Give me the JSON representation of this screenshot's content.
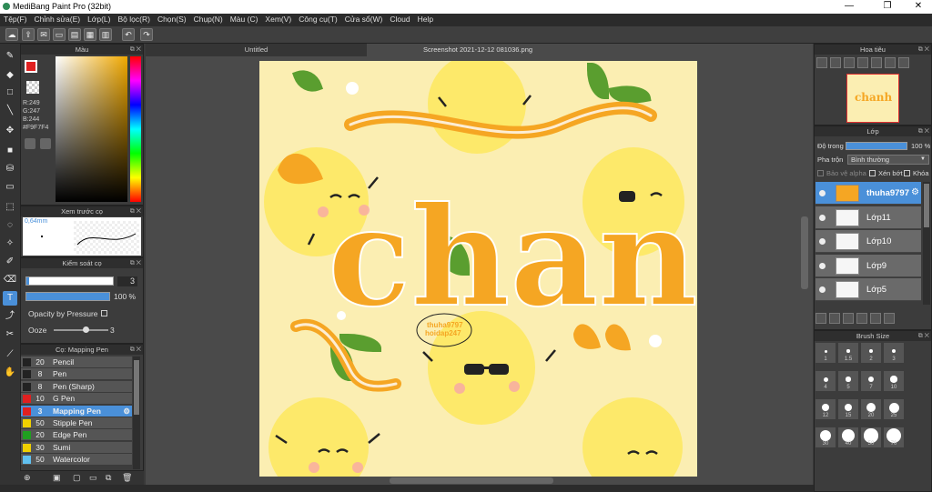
{
  "window": {
    "title": "MediBang Paint Pro (32bit)",
    "minimize": "—",
    "maximize": "❐",
    "close": "✕"
  },
  "menu": [
    "Tệp(F)",
    "Chỉnh sửa(E)",
    "Lớp(L)",
    "Bộ lọc(R)",
    "Chọn(S)",
    "Chụp(N)",
    "Màu (C)",
    "Xem(V)",
    "Công cụ(T)",
    "Cửa sổ(W)",
    "Cloud",
    "Help"
  ],
  "color_panel": {
    "title": "Màu",
    "r": "R:249",
    "g": "G:247",
    "b": "B:244",
    "hex": "#F9F7F4"
  },
  "brush_preview": {
    "title": "Xem trước cọ",
    "size": "0,64mm"
  },
  "brush_control": {
    "title": "Kiểm soát cọ",
    "size_value": "3",
    "opacity_value": "100 %",
    "opacity_pressure": "Opacity by Pressure",
    "ooze_label": "Ooze",
    "ooze_value": "3"
  },
  "brush_list": {
    "title": "Cọ: Mapping Pen",
    "items": [
      {
        "size": "20",
        "name": "Pencil",
        "color": "#222222"
      },
      {
        "size": "8",
        "name": "Pen",
        "color": "#222222"
      },
      {
        "size": "8",
        "name": "Pen (Sharp)",
        "color": "#222222"
      },
      {
        "size": "10",
        "name": "G Pen",
        "color": "#e02020"
      },
      {
        "size": "3",
        "name": "Mapping Pen",
        "color": "#e02020"
      },
      {
        "size": "50",
        "name": "Stipple Pen",
        "color": "#f0d000"
      },
      {
        "size": "20",
        "name": "Edge Pen",
        "color": "#20a020"
      },
      {
        "size": "30",
        "name": "Sumi",
        "color": "#f0d000"
      },
      {
        "size": "50",
        "name": "Watercolor",
        "color": "#60c0f0"
      }
    ]
  },
  "tabs": {
    "untitled": "Untitled",
    "screenshot": "Screenshot 2021-12-12 081036.png"
  },
  "artwork": {
    "word": "chanh",
    "signature_line1": "thuha9797",
    "signature_line2": "hoidap247"
  },
  "navigator": {
    "title": "Hoa tiêu"
  },
  "layers": {
    "title": "Lớp",
    "opacity_label": "Độ trong",
    "opacity_value": "100 %",
    "blend_label": "Pha trộn",
    "blend_value": "Bình thường",
    "protect_alpha": "Bảo vệ alpha",
    "clipping": "Xén bớt",
    "lock": "Khóa",
    "items": [
      "thuha9797",
      "Lớp11",
      "Lớp10",
      "Lớp9",
      "Lớp5"
    ]
  },
  "brush_size": {
    "title": "Brush Size",
    "sizes": [
      "1",
      "1.5",
      "2",
      "3",
      "4",
      "5",
      "7",
      "10",
      "12",
      "15",
      "20",
      "25",
      "30",
      "40",
      "50",
      "70"
    ]
  },
  "colors": {
    "accent": "#4a90d9",
    "canvas_bg": "#fbeeb2",
    "lemon": "#fde96a",
    "orange": "#f5a623"
  }
}
